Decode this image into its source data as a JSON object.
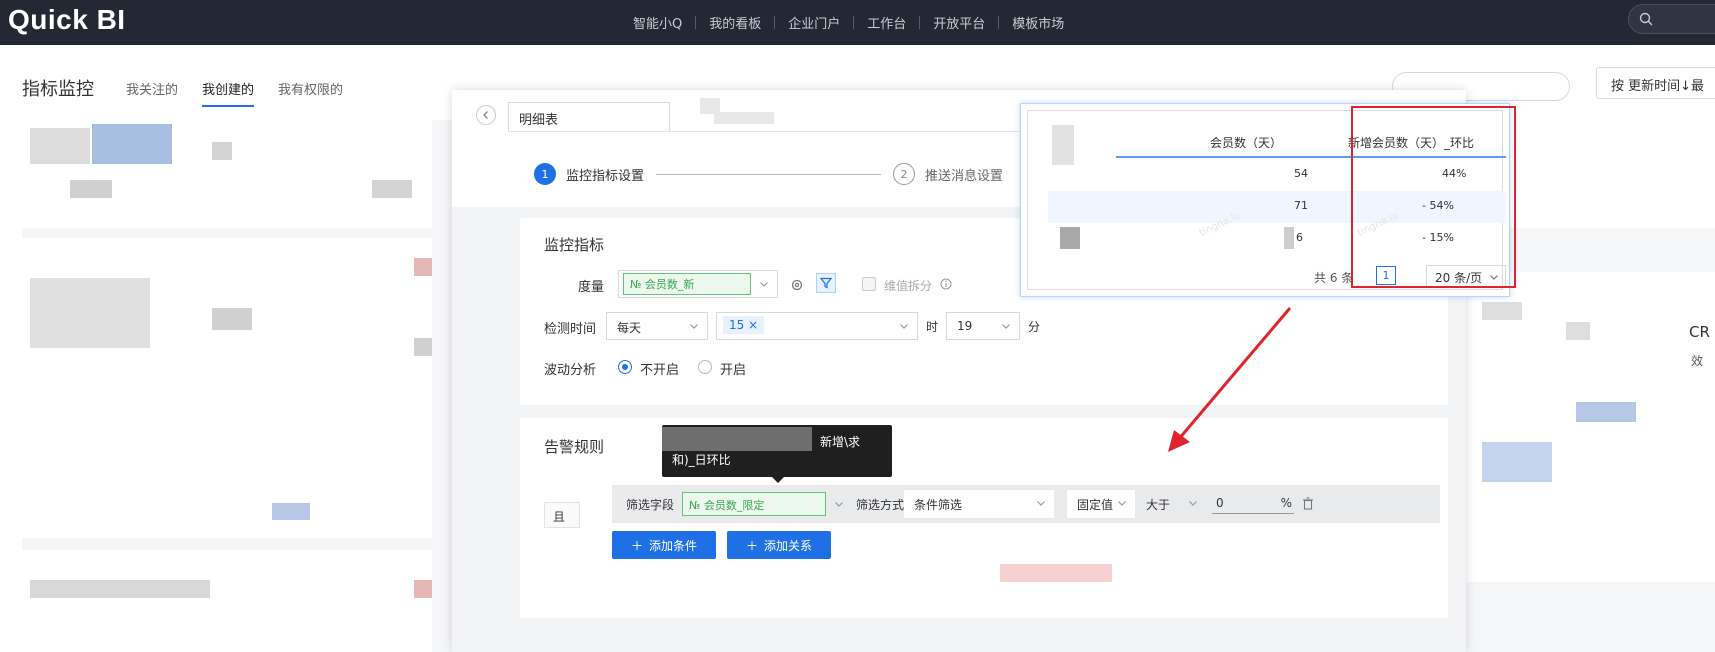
{
  "topbar": {
    "logo": "Quick BI",
    "nav": [
      "智能小Q",
      "我的看板",
      "企业门户",
      "工作台",
      "开放平台",
      "模板市场"
    ]
  },
  "page": {
    "title": "指标监控",
    "tabs": [
      "我关注的",
      "我创建的",
      "我有权限的"
    ],
    "active_tab": "我创建的",
    "sort_label": "按 更新时间↓最",
    "cr_label": "CR",
    "cr_sub": "效"
  },
  "modal": {
    "name_value": "明细表",
    "steps": [
      {
        "num": "1",
        "label": "监控指标设置"
      },
      {
        "num": "2",
        "label": "推送消息设置"
      }
    ],
    "monitor": {
      "section_title": "监控指标",
      "measure_label": "度量",
      "measure_tag": "№ 会员数_新",
      "dim_split_label": "维值拆分",
      "detect_time_label": "检测时间",
      "frequency": "每天",
      "day_tag": "15 ×",
      "hour_label": "时",
      "hour_value": "19",
      "minute_label": "分",
      "fluct_label": "波动分析",
      "fluct_off": "不开启",
      "fluct_on": "开启"
    },
    "alert": {
      "section_title": "告警规则",
      "logic": "且",
      "filter_field_label": "筛选字段",
      "filter_field_tag": "№ 会员数_限定",
      "filter_method_label": "筛选方式",
      "filter_method": "条件筛选",
      "value_type": "固定值",
      "operator": "大于",
      "value": "0",
      "unit": "%",
      "add_condition": "添加条件",
      "add_relation": "添加关系"
    },
    "tooltip": {
      "line1": "新增\\求",
      "line2": "和)_日环比"
    }
  },
  "popover": {
    "columns": [
      "会员数（天）",
      "新增会员数（天）_环比"
    ],
    "rows": [
      {
        "count": "54",
        "ratio": "44%"
      },
      {
        "count": "71",
        "ratio": "- 54%"
      },
      {
        "count": "6",
        "ratio": "- 15%"
      }
    ],
    "total": "共 6 条",
    "page": "1",
    "page_size": "20 条/页",
    "watermark": "tingna.lu"
  },
  "colors": {
    "accent": "#1f6fe5",
    "topbar": "#232833",
    "highlight_red": "#e0242b",
    "tag_green": "#3aa755"
  }
}
